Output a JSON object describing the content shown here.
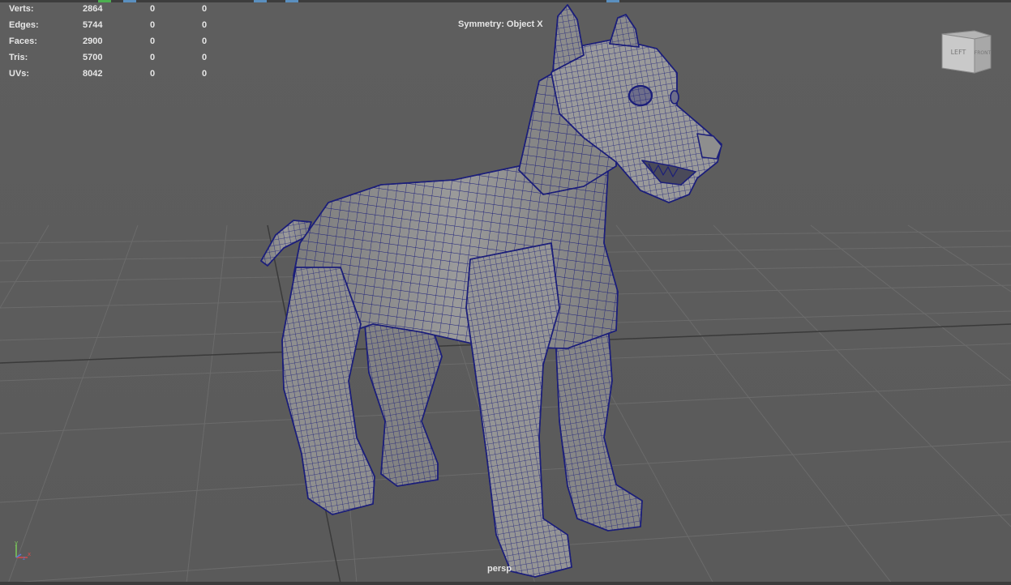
{
  "hud": {
    "rows": [
      {
        "label": "Verts:",
        "total": "2864",
        "selected": "0",
        "component": "0"
      },
      {
        "label": "Edges:",
        "total": "5744",
        "selected": "0",
        "component": "0"
      },
      {
        "label": "Faces:",
        "total": "2900",
        "selected": "0",
        "component": "0"
      },
      {
        "label": "Tris:",
        "total": "5700",
        "selected": "0",
        "component": "0"
      },
      {
        "label": "UVs:",
        "total": "8042",
        "selected": "0",
        "component": "0"
      }
    ]
  },
  "symmetry": "Symmetry: Object X",
  "camera": "persp",
  "view_cube": {
    "left": "LEFT",
    "front": "FRONT"
  },
  "axis": {
    "y": "y",
    "x": "x",
    "z": "z"
  },
  "colors": {
    "background": "#5d5d5d",
    "grid": "#6b6b6b",
    "grid_axis": "#3a3a3a",
    "mesh_fill": "#8a8a8a",
    "wireframe": "#1b1e7a",
    "hud_text": "#e6e6e6"
  },
  "icons": [
    "view-cube-icon",
    "axis-gizmo-icon"
  ]
}
